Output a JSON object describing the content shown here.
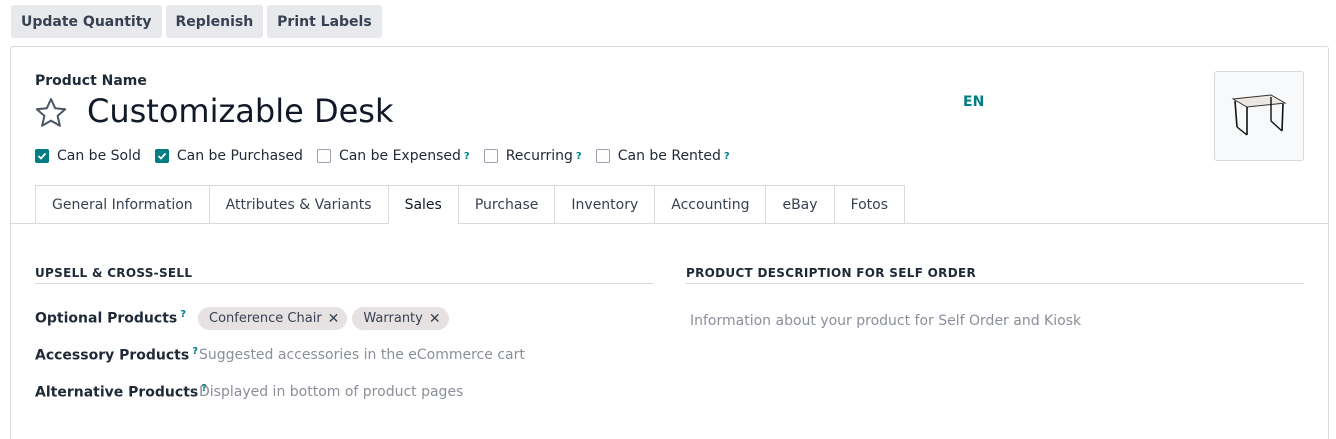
{
  "actions": {
    "update_quantity": "Update Quantity",
    "replenish": "Replenish",
    "print_labels": "Print Labels"
  },
  "product": {
    "name_label": "Product Name",
    "name": "Customizable Desk",
    "language": "EN",
    "favorite_icon": "star-outline-icon"
  },
  "flags": [
    {
      "label": "Can be Sold",
      "checked": true,
      "help": ""
    },
    {
      "label": "Can be Purchased",
      "checked": true,
      "help": ""
    },
    {
      "label": "Can be Expensed",
      "checked": false,
      "help": "?"
    },
    {
      "label": "Recurring",
      "checked": false,
      "help": "?"
    },
    {
      "label": "Can be Rented",
      "checked": false,
      "help": "?"
    }
  ],
  "tabs": [
    {
      "label": "General Information"
    },
    {
      "label": "Attributes & Variants"
    },
    {
      "label": "Sales",
      "active": true
    },
    {
      "label": "Purchase"
    },
    {
      "label": "Inventory"
    },
    {
      "label": "Accounting"
    },
    {
      "label": "eBay"
    },
    {
      "label": "Fotos"
    }
  ],
  "upsell": {
    "title": "UPSELL & CROSS-SELL",
    "optional_label": "Optional Products",
    "optional_tags": [
      "Conference Chair",
      "Warranty"
    ],
    "accessory_label": "Accessory Products",
    "accessory_placeholder": "Suggested accessories in the eCommerce cart",
    "alternative_label": "Alternative Products",
    "alternative_placeholder": "Displayed in bottom of product pages",
    "help": "?"
  },
  "self_order": {
    "title": "PRODUCT DESCRIPTION FOR SELF ORDER",
    "placeholder": "Information about your product for Self Order and Kiosk"
  },
  "colors": {
    "accent": "#017e84",
    "tag_bg": "#e6e2e2",
    "button_bg": "#e7e9ed"
  }
}
